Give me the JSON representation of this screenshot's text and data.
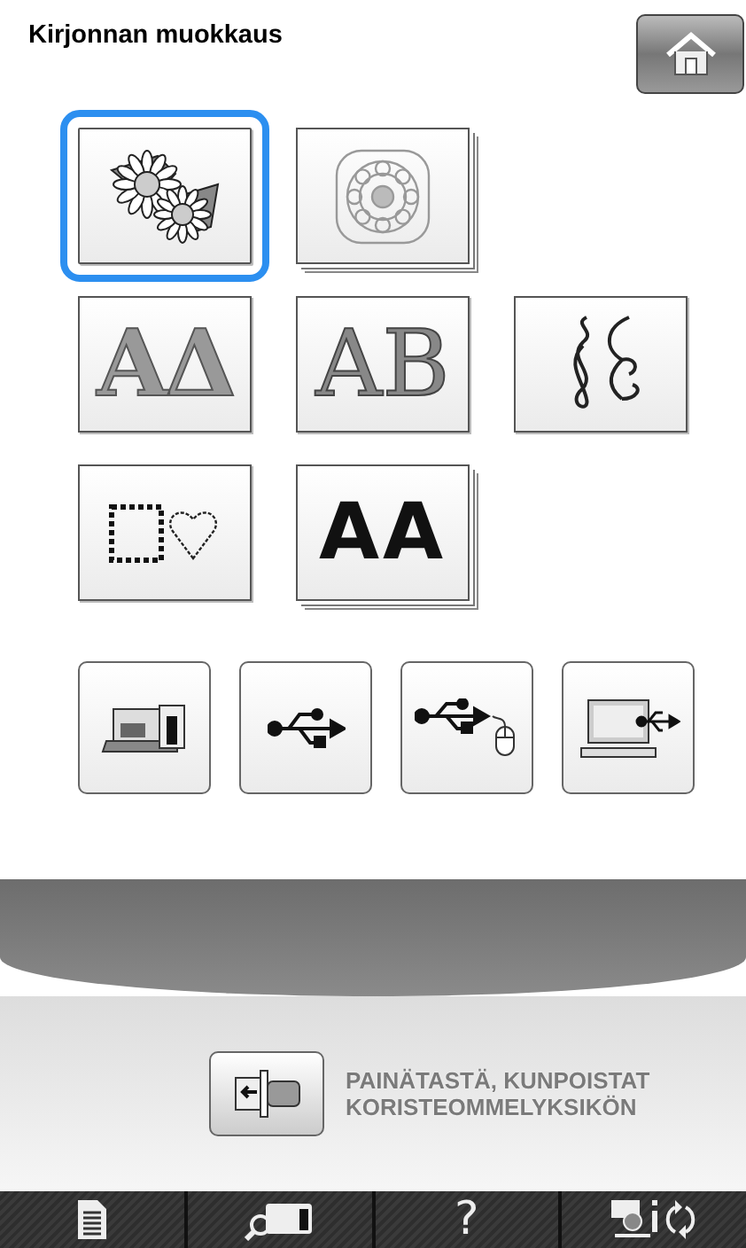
{
  "title": "Kirjonnan muokkaus",
  "category_rows": [
    [
      {
        "kind": "flowers",
        "selected": true,
        "stacked": false
      },
      {
        "kind": "lace",
        "selected": false,
        "stacked": true
      }
    ],
    [
      {
        "kind": "outline-letters",
        "text": "AΔ",
        "selected": false,
        "stacked": false
      },
      {
        "kind": "floral-letters",
        "text": "AB",
        "selected": false,
        "stacked": false
      },
      {
        "kind": "swirl",
        "selected": false,
        "stacked": false
      }
    ],
    [
      {
        "kind": "frames",
        "selected": false,
        "stacked": false
      },
      {
        "kind": "font-letters",
        "text": "AA",
        "selected": false,
        "stacked": true
      }
    ]
  ],
  "sources": [
    {
      "kind": "machine"
    },
    {
      "kind": "usb"
    },
    {
      "kind": "usb-mouse"
    },
    {
      "kind": "computer"
    }
  ],
  "notice": {
    "lines": [
      "PAINÄTASTÄ, KUNPOISTAT",
      "KORISTEOMMELYKSIKÖN"
    ]
  },
  "toolbar": [
    {
      "kind": "page"
    },
    {
      "kind": "machine"
    },
    {
      "kind": "help",
      "text": "?"
    },
    {
      "kind": "foot"
    }
  ]
}
